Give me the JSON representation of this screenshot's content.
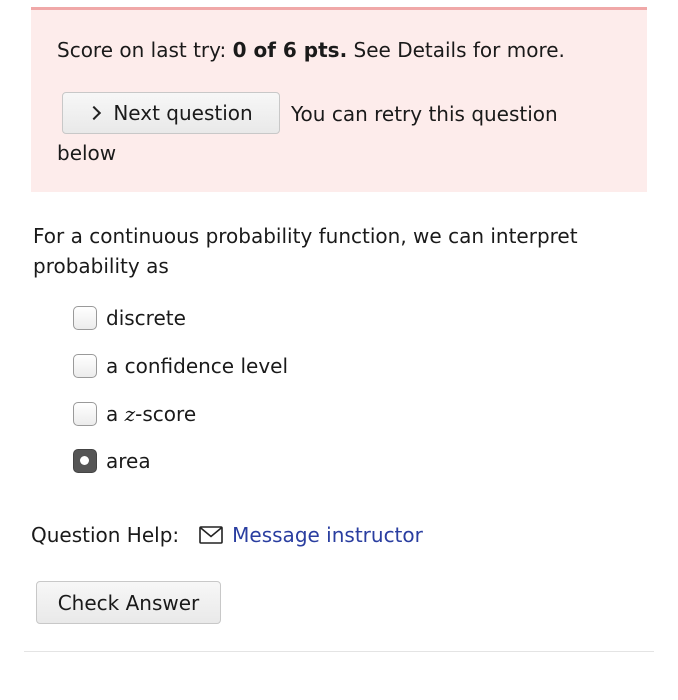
{
  "banner": {
    "score_prefix": "Score on last try: ",
    "score_value": "0 of 6 pts.",
    "score_suffix": " See Details for more.",
    "next_button_label": "Next question",
    "retry_text_line1": "You can retry this question",
    "retry_text_line2": "below"
  },
  "question": {
    "text": "For a continuous probability function, we can interpret probability as",
    "options": [
      {
        "label": "discrete",
        "checked": false
      },
      {
        "label": "a confidence level",
        "checked": false
      },
      {
        "label_prefix": "a ",
        "label_var": "z",
        "label_suffix": "-score",
        "checked": false
      },
      {
        "label": "area",
        "checked": true
      }
    ]
  },
  "help": {
    "label": "Question Help:",
    "link_icon": "mail-icon",
    "link_text": "Message instructor"
  },
  "check_button_label": "Check Answer",
  "colors": {
    "banner_bg": "#fdeceb",
    "banner_border": "#f0a8a8",
    "link": "#2a3ea0"
  }
}
